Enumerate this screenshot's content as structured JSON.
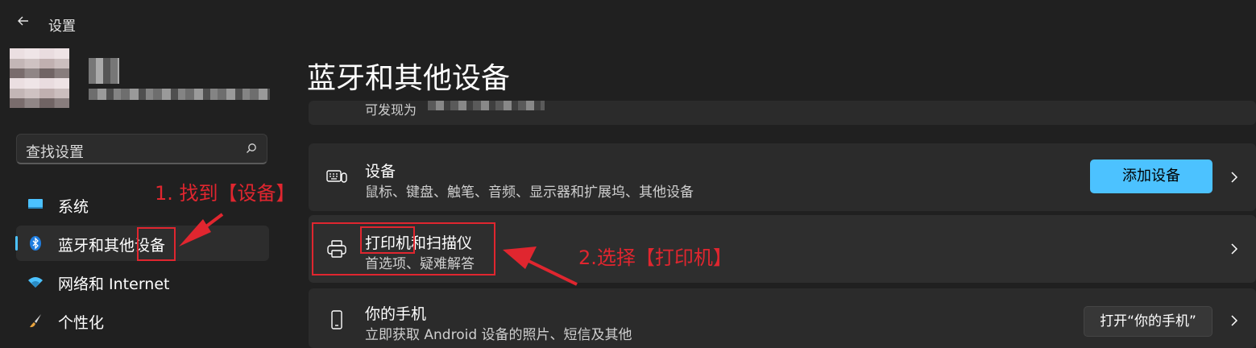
{
  "window": {
    "title": "设置"
  },
  "search": {
    "placeholder": "查找设置"
  },
  "sidebar": {
    "items": [
      {
        "label": "系统",
        "icon": "monitor-icon"
      },
      {
        "label": "蓝牙和其他设备",
        "icon": "bluetooth-icon",
        "active": true
      },
      {
        "label": "网络和 Internet",
        "icon": "wifi-icon"
      },
      {
        "label": "个性化",
        "icon": "brush-icon"
      }
    ]
  },
  "page": {
    "title": "蓝牙和其他设备"
  },
  "discoverable": {
    "label": "可发现为"
  },
  "rows": {
    "devices": {
      "title": "设备",
      "desc": "鼠标、键盘、触笔、音频、显示器和扩展坞、其他设备",
      "button": "添加设备"
    },
    "printers": {
      "title": "打印机和扫描仪",
      "desc": "首选项、疑难解答"
    },
    "phone": {
      "title": "你的手机",
      "desc": "立即获取 Android 设备的照片、短信及其他",
      "button": "打开“你的手机”"
    }
  },
  "annotations": {
    "step1": "1. 找到【设备】",
    "step2": "2.选择【打印机】"
  },
  "colors": {
    "accent": "#4cc2ff",
    "annotation": "#e0262f",
    "background": "#202020"
  }
}
